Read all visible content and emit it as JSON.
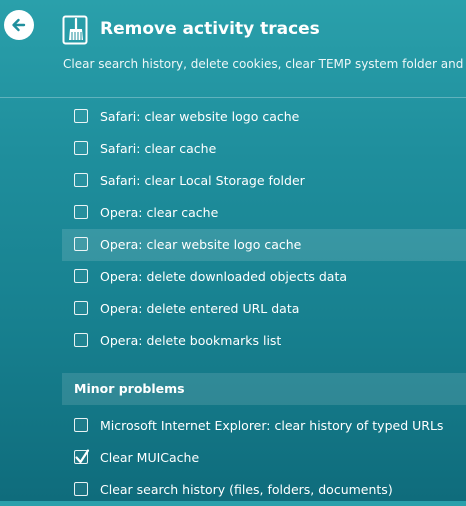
{
  "header": {
    "title": "Remove activity traces",
    "subtitle": "Clear search history, delete cookies, clear TEMP system folder and W"
  },
  "items": [
    {
      "label": "Safari: clear website logo cache",
      "checked": false
    },
    {
      "label": "Safari: clear cache",
      "checked": false
    },
    {
      "label": "Safari: clear Local Storage folder",
      "checked": false
    },
    {
      "label": "Opera: clear cache",
      "checked": false
    },
    {
      "label": "Opera: clear website logo cache",
      "checked": false,
      "highlighted": true
    },
    {
      "label": "Opera: delete downloaded objects data",
      "checked": false
    },
    {
      "label": "Opera: delete entered URL data",
      "checked": false
    },
    {
      "label": "Opera: delete bookmarks list",
      "checked": false
    }
  ],
  "minor": {
    "title": "Minor problems",
    "items": [
      {
        "label": "Microsoft Internet Explorer: clear history of typed URLs",
        "checked": false
      },
      {
        "label": "Clear MUICache",
        "checked": true
      },
      {
        "label": "Clear search history (files, folders, documents)",
        "checked": false
      }
    ]
  },
  "icons": {
    "back": "back-arrow-icon",
    "app": "broom-icon"
  },
  "colors": {
    "background_top": "#2aa0ab",
    "background_bottom": "#0f6c7c",
    "accent_back_arrow": "#1f8f9d"
  }
}
